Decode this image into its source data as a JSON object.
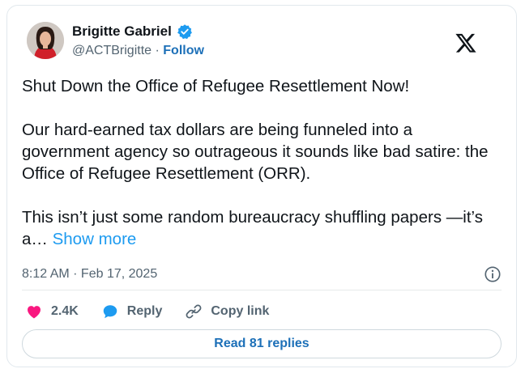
{
  "author": {
    "name": "Brigitte Gabriel",
    "handle": "@ACTBrigitte",
    "separator": "·",
    "follow_label": "Follow",
    "verified": true
  },
  "icons": {
    "verified": "verified-badge-icon",
    "platform": "x-logo-icon",
    "info": "info-icon",
    "like": "heart-icon",
    "reply": "speech-bubble-icon",
    "copy_link": "link-icon"
  },
  "tweet": {
    "paragraphs": [
      "Shut Down the Office of Refugee Resettlement Now!",
      "Our hard-earned tax dollars are being funneled into a government agency so outrageous it sounds like bad satire: the Office of Refugee Resettlement (ORR).",
      "This isn’t just some random bureaucracy shuffling papers —it’s a… "
    ],
    "show_more_label": "Show more"
  },
  "meta": {
    "timestamp": "8:12 AM · Feb 17, 2025"
  },
  "actions": {
    "likes": "2.4K",
    "reply_label": "Reply",
    "copy_link_label": "Copy link"
  },
  "footer": {
    "read_replies_label": "Read 81 replies"
  },
  "colors": {
    "link": "#1d70b8",
    "verified": "#1d9bf0",
    "heart": "#f91880",
    "text": "#0f1419",
    "muted": "#536471"
  }
}
